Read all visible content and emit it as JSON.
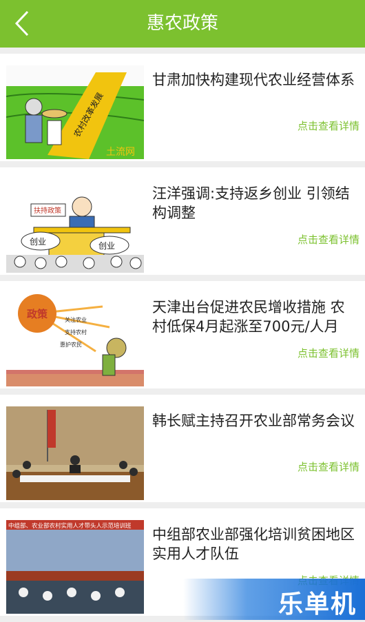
{
  "header": {
    "title": "惠农政策"
  },
  "detail_label": "点击查看详情",
  "articles": [
    {
      "headline": "甘肃加快构建现代农业经营体系",
      "thumb_text": "农村改革发展",
      "thumb_logo": "土流网"
    },
    {
      "headline": "汪洋强调:支持返乡创业 引领结构调整",
      "thumb_sign": "扶持政策",
      "thumb_bubble1": "创业",
      "thumb_bubble2": "创业"
    },
    {
      "headline": "天津出台促进农民增收措施 农村低保4月起涨至700元/人月",
      "thumb_sun": "政策",
      "thumb_ray1": "关注农业",
      "thumb_ray2": "支持农村",
      "thumb_ray3": "惠护农民"
    },
    {
      "headline": "韩长赋主持召开农业部常务会议"
    },
    {
      "headline": "中组部农业部强化培训贫困地区实用人才队伍",
      "thumb_banner": "中组部、农业部农村实用人才带头人示范培训班"
    }
  ],
  "watermark": "乐单机",
  "colors": {
    "accent": "#7cc12f"
  }
}
